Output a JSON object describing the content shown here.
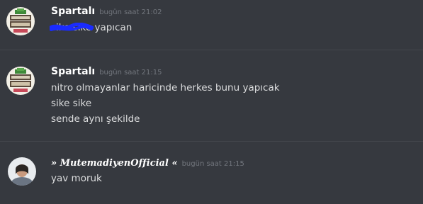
{
  "messages": [
    {
      "author": "Spartalı",
      "timestamp": "bugün saat 21:02",
      "avatar": "craft-logo-avatar",
      "scribbled_text": "sike sike",
      "text": "yapıcan"
    },
    {
      "author": "Spartalı",
      "timestamp": "bugün saat 21:15",
      "avatar": "craft-logo-avatar",
      "lines": [
        "nitro olmayanlar haricinde herkes bunu yapıcak",
        "sike sike",
        "sende aynı şekilde"
      ]
    },
    {
      "author": "» 𝑴𝒖𝒕𝒆𝒎𝒂𝒅𝒊𝒚𝒆𝒏𝑶𝒇𝒇𝒊𝒄𝒊𝒂𝒍 «",
      "timestamp": "bugün saat 21:15",
      "avatar": "user-photo-avatar",
      "lines": [
        "yav moruk"
      ]
    }
  ],
  "colors": {
    "background": "#36393f",
    "username": "#ffffff",
    "timestamp": "#72767d",
    "text": "#dcddde",
    "scribble": "#1a2bff",
    "divider": "#43464c"
  }
}
